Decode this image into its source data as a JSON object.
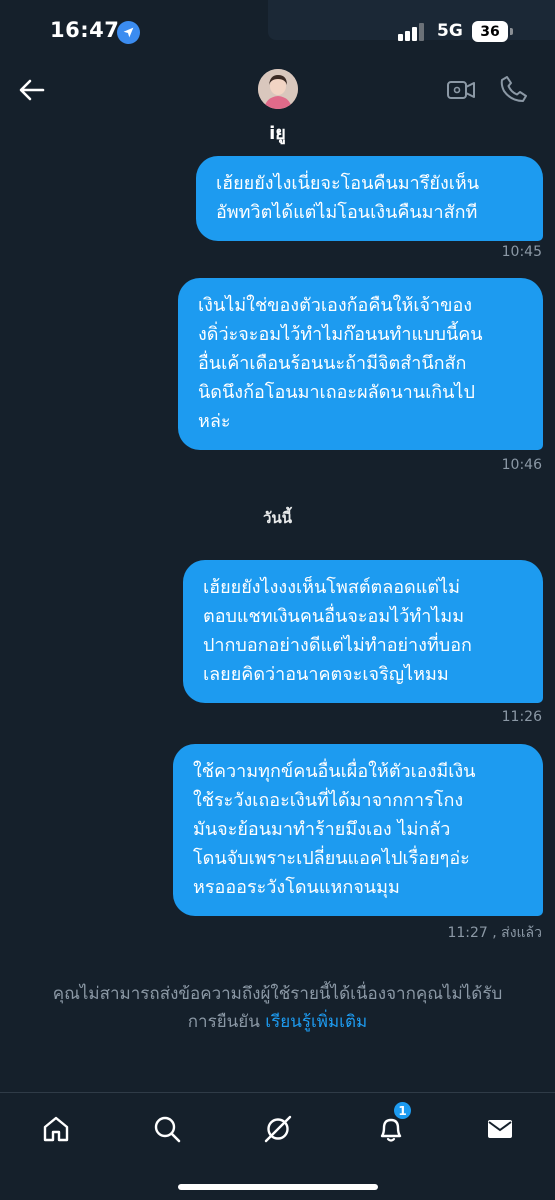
{
  "status_bar": {
    "time": "16:47",
    "network": "5G",
    "battery": "36"
  },
  "header": {
    "contact_name": "iยู"
  },
  "messages": [
    {
      "lines": [
        "เฮ้ยยยังไงเนี่ยจะโอนคืนมารึยังเห็น",
        "อัพทวิตได้แต่ไม่โอนเงินคืนมาสักที"
      ],
      "time": "10:45"
    },
    {
      "lines": [
        "เงินไม่ใช่ของตัวเองก้อคืนให้เจ้าของ",
        "งดิ่ว่ะจะอมไว้ทำไมก๊อนนทำแบบนี้คน",
        "อื่นเค้าเดือนร้อนนะถ้ามีจิตสำนึกสัก",
        "นิดนึงก้อโอนมาเถอะผลัดนานเกินไป",
        "หล่ะ"
      ],
      "time": "10:46"
    },
    {
      "lines": [
        "เฮ้ยยยังไงงงเห็นโพสต์ตลอดแต่ไม่",
        "ตอบแชทเงินคนอื่นจะอมไว้ทำไมม",
        "ปากบอกอย่างดีแต่ไม่ทำอย่างที่บอก",
        "เลยยคิดว่าอนาคตจะเจริญไหมม"
      ],
      "time": "11:26"
    },
    {
      "lines": [
        "ใช้ความทุกข์คนอื่นเผื่อให้ตัวเองมีเงิน",
        "ใช้ระวังเถอะเงินที่ได้มาจากการโกง",
        "มันจะย้อนมาทำร้ายมึงเอง ไม่กลัว",
        "โดนจับเพราะเปลี่ยนแอคไปเรื่อยๆอ่ะ",
        "หรอออระวังโดนแหกจนมุม"
      ],
      "time": "11:27 , ส่งแล้ว"
    }
  ],
  "day_separator": "วันนี้",
  "notice": {
    "line1": "คุณไม่สามารถส่งข้อความถึงผู้ใช้รายนี้ได้เนื่องจากคุณไม่ได้รับ",
    "line2_prefix": "การยืนยัน",
    "link": "เรียนรู้เพิ่มเติม"
  },
  "nav": {
    "items": [
      "home-icon",
      "search-icon",
      "spaces-icon",
      "notifications-icon",
      "messages-icon"
    ],
    "notification_badge": "1"
  },
  "colors": {
    "background": "#15202b",
    "accent": "#1d9bf0",
    "secondary_text": "#8b98a5"
  }
}
